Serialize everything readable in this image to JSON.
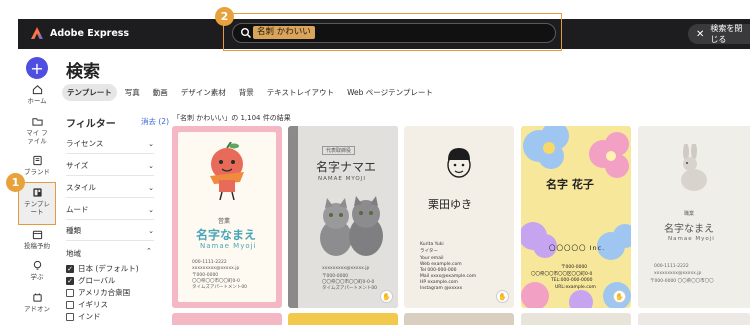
{
  "app": {
    "name": "Adobe Express"
  },
  "search": {
    "value": "名刺 かわいい",
    "close_label": "検索を閉じる"
  },
  "callouts": {
    "one": "1",
    "two": "2"
  },
  "rail": {
    "create": "+",
    "items": [
      {
        "label": "ホーム",
        "icon": "home-icon"
      },
      {
        "label": "マイ ファイル",
        "icon": "folder-icon"
      },
      {
        "label": "ブランド",
        "icon": "brand-icon"
      },
      {
        "label": "テンプレート",
        "icon": "template-icon"
      },
      {
        "label": "投稿予約",
        "icon": "calendar-icon"
      },
      {
        "label": "学ぶ",
        "icon": "learn-icon"
      },
      {
        "label": "アドオン",
        "icon": "addon-icon"
      }
    ]
  },
  "page": {
    "title": "検索"
  },
  "tabs": [
    "テンプレート",
    "写真",
    "動画",
    "デザイン素材",
    "背景",
    "テキストレイアウト",
    "Web ページテンプレート"
  ],
  "filters": {
    "title": "フィルター",
    "clear": "消去 (2)",
    "groups": [
      "ライセンス",
      "サイズ",
      "スタイル",
      "ムード",
      "種類"
    ],
    "region_title": "地域",
    "region_options": [
      {
        "label": "日本 (デフォルト)",
        "checked": true
      },
      {
        "label": "グローバル",
        "checked": true
      },
      {
        "label": "アメリカ合衆国",
        "checked": false
      },
      {
        "label": "イギリス",
        "checked": false
      },
      {
        "label": "インド",
        "checked": false
      }
    ]
  },
  "results": {
    "summary": "「名刺 かわいい」の 1,104 件の結果"
  },
  "cards": [
    {
      "label_top": "営業",
      "name": "名字なまえ",
      "romaji": "Namae Myoji",
      "lines": [
        "000-1111-2222",
        "xxxxxxxxx@xxxxx.jp",
        "〒000-0000",
        "〇〇県〇〇市〇〇町0-0",
        "タイムズアパートメント00"
      ]
    },
    {
      "label_top": "代表取締役",
      "name": "名字ナマエ",
      "romaji": "NAMAE MYOJI",
      "lines": [
        "xxxxxxxxx@xxxxx.jp",
        "〒000-0000",
        "〇〇県〇〇市〇〇町0-0-0",
        "タイムズアパートメント00"
      ]
    },
    {
      "name": "栗田ゆき",
      "lines": [
        "Kurita Yuki",
        "ライター",
        "Your email",
        "Web example.com",
        "Tel 000-000-000",
        "Mail xxxx@example.com",
        "HP example.com",
        "Instagram @xxxxx"
      ]
    },
    {
      "name": "名字 花子",
      "company": "〇〇〇〇〇 Inc.",
      "lines": [
        "〒000-0000",
        "〇〇県〇〇市〇〇区〇〇町0-0",
        "TEL:000-000-0000",
        "URL:example.com"
      ]
    },
    {
      "label_top": "職業",
      "name": "名字なまえ",
      "romaji": "Namae Myoji",
      "lines": [
        "000-1111-2222",
        "xxxxxxxxx@xxxxx.jp",
        "〒000-0000 〇〇県〇〇市〇〇"
      ]
    }
  ],
  "colors": {
    "accent": "#e59a3c",
    "create": "#4e4ee0",
    "link": "#3b63d3"
  }
}
